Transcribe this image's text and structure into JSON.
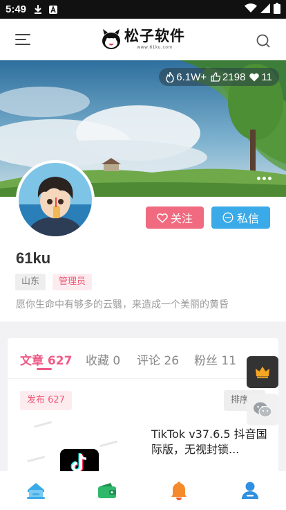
{
  "status_bar": {
    "time": "5:49",
    "icons": [
      "download-icon",
      "app-icon",
      "wifi-icon",
      "signal-icon",
      "battery-icon"
    ]
  },
  "header": {
    "logo_text": "松子软件",
    "logo_sub": "www.61ku.com",
    "left_icon": "menu-icon",
    "right_icon": "search-icon"
  },
  "cover": {
    "stats": {
      "views": "6.1W+",
      "likes": "2198",
      "favorites": "11"
    }
  },
  "profile": {
    "username": "61ku",
    "location_tag": "山东",
    "role_tag": "管理员",
    "bio": "愿你生命中有够多的云翳，来造成一个美丽的黄昏",
    "follow_label": "关注",
    "message_label": "私信"
  },
  "tabs": [
    {
      "label": "文章 627",
      "active": true
    },
    {
      "label": "收藏 0",
      "active": false
    },
    {
      "label": "评论 26",
      "active": false
    },
    {
      "label": "粉丝 11",
      "active": false
    }
  ],
  "list": {
    "publish_badge": "发布 627",
    "sort_label": "排序",
    "article": {
      "title": "TikTok v37.6.5 抖音国际版，无视封锁..."
    }
  },
  "colors": {
    "accent_pink": "#ee5a86",
    "follow": "#f06a80",
    "message": "#3aaae8",
    "nav_home": "#3aaae8",
    "nav_wallet": "#2fb86a",
    "nav_bell": "#f58a2c",
    "nav_user": "#2f8fe0"
  },
  "bottom_nav": [
    {
      "icon": "home-icon",
      "active": true
    },
    {
      "icon": "wallet-icon",
      "active": false
    },
    {
      "icon": "bell-icon",
      "active": false
    },
    {
      "icon": "user-icon",
      "active": false
    }
  ]
}
